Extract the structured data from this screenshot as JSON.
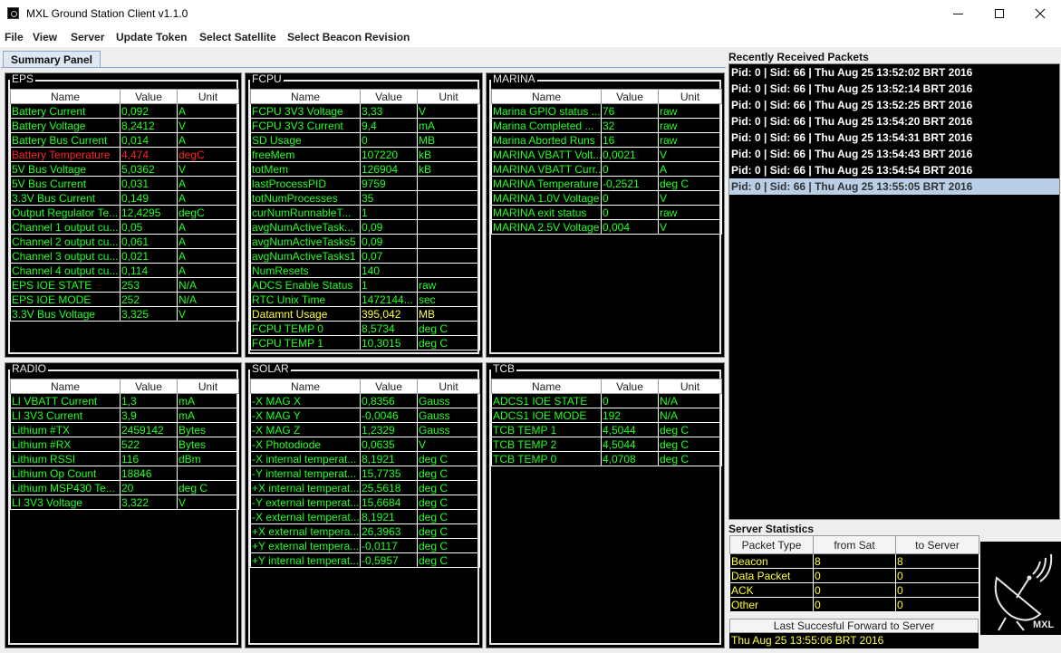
{
  "window": {
    "title": "MXL Ground Station Client v1.1.0"
  },
  "menu": [
    "File",
    "View",
    "Server",
    "Update Token",
    "Select Satellite",
    "Select Beacon Revision"
  ],
  "tabs": [
    {
      "label": "Summary Panel",
      "active": true
    }
  ],
  "columns": {
    "name": "Name",
    "value": "Value",
    "unit": "Unit"
  },
  "panels": {
    "eps": {
      "title": "EPS",
      "rows": [
        {
          "name": "Battery Current",
          "value": "0,092",
          "unit": "A"
        },
        {
          "name": "Battery Voltage",
          "value": "8,2412",
          "unit": "V"
        },
        {
          "name": "Battery Bus Current",
          "value": "0,014",
          "unit": "A"
        },
        {
          "name": "Battery Temperature",
          "value": "4,474",
          "unit": "degC",
          "alert": "red"
        },
        {
          "name": "5V Bus Voltage",
          "value": "5,0362",
          "unit": "V"
        },
        {
          "name": "5V Bus Current",
          "value": "0,031",
          "unit": "A"
        },
        {
          "name": "3.3V Bus Current",
          "value": "0,149",
          "unit": "A"
        },
        {
          "name": "Output Regulator Te...",
          "value": "12,4295",
          "unit": "degC"
        },
        {
          "name": "Channel 1 output cu...",
          "value": "0,05",
          "unit": "A"
        },
        {
          "name": "Channel 2 output cu...",
          "value": "0,061",
          "unit": "A"
        },
        {
          "name": "Channel 3 output cu...",
          "value": "0,021",
          "unit": "A"
        },
        {
          "name": "Channel 4 output cu...",
          "value": "0,114",
          "unit": "A"
        },
        {
          "name": "EPS IOE STATE",
          "value": "253",
          "unit": "N/A"
        },
        {
          "name": "EPS IOE MODE",
          "value": "252",
          "unit": "N/A"
        },
        {
          "name": "3.3V Bus Voltage",
          "value": "3,325",
          "unit": "V"
        }
      ]
    },
    "fcpu": {
      "title": "FCPU",
      "rows": [
        {
          "name": "FCPU 3V3 Voltage",
          "value": "3,33",
          "unit": "V"
        },
        {
          "name": "FCPU 3V3 Current",
          "value": "9,4",
          "unit": "mA"
        },
        {
          "name": "SD Usage",
          "value": "0",
          "unit": "MB"
        },
        {
          "name": "freeMem",
          "value": "107220",
          "unit": "kB"
        },
        {
          "name": "totMem",
          "value": "126904",
          "unit": "kB"
        },
        {
          "name": "lastProcessPID",
          "value": "9759",
          "unit": ""
        },
        {
          "name": "totNumProcesses",
          "value": "35",
          "unit": ""
        },
        {
          "name": "curNumRunnableT...",
          "value": "1",
          "unit": ""
        },
        {
          "name": "avgNumActiveTask...",
          "value": "0,09",
          "unit": ""
        },
        {
          "name": "avgNumActiveTasks5",
          "value": "0,09",
          "unit": ""
        },
        {
          "name": "avgNumActiveTasks1",
          "value": "0,07",
          "unit": ""
        },
        {
          "name": "NumResets",
          "value": "140",
          "unit": ""
        },
        {
          "name": "ADCS Enable Status",
          "value": "1",
          "unit": "raw"
        },
        {
          "name": "RTC Unix Time",
          "value": "1472144...",
          "unit": "sec"
        },
        {
          "name": "Datamnt Usage",
          "value": "395,042",
          "unit": "MB",
          "alert": "yellow"
        },
        {
          "name": "FCPU TEMP 0",
          "value": "8,5734",
          "unit": "deg C"
        },
        {
          "name": "FCPU TEMP 1",
          "value": "10,3015",
          "unit": "deg C"
        }
      ]
    },
    "marina": {
      "title": "MARINA",
      "rows": [
        {
          "name": "Marina GPIO status ...",
          "value": "76",
          "unit": "raw"
        },
        {
          "name": "Marina Completed ...",
          "value": "32",
          "unit": "raw"
        },
        {
          "name": "Marina Aborted Runs",
          "value": "16",
          "unit": "raw"
        },
        {
          "name": "MARINA VBATT Volt...",
          "value": "0,0021",
          "unit": "V"
        },
        {
          "name": "MARINA VBATT Curr...",
          "value": "0",
          "unit": "A"
        },
        {
          "name": "MARINA Temperature",
          "value": "-0,2521",
          "unit": "deg C"
        },
        {
          "name": "MARINA 1.0V Voltage",
          "value": "0",
          "unit": "V"
        },
        {
          "name": "MARINA exit status",
          "value": "0",
          "unit": "raw"
        },
        {
          "name": "MARINA 2.5V Voltage",
          "value": "0,004",
          "unit": "V"
        }
      ]
    },
    "radio": {
      "title": "RADIO",
      "rows": [
        {
          "name": "LI VBATT Current",
          "value": "1,3",
          "unit": "mA"
        },
        {
          "name": "LI 3V3 Current",
          "value": "3,9",
          "unit": "mA"
        },
        {
          "name": "Lithium #TX",
          "value": "2459142",
          "unit": "Bytes"
        },
        {
          "name": "Lithium #RX",
          "value": "522",
          "unit": "Bytes"
        },
        {
          "name": "Lithium RSSI",
          "value": "116",
          "unit": "dBm"
        },
        {
          "name": "Lithium Op Count",
          "value": "18846",
          "unit": ""
        },
        {
          "name": "Lithium MSP430 Te...",
          "value": "20",
          "unit": "deg C"
        },
        {
          "name": "LI 3V3 Voltage",
          "value": "3,322",
          "unit": "V"
        }
      ]
    },
    "solar": {
      "title": "SOLAR",
      "rows": [
        {
          "name": "-X MAG X",
          "value": "0,8356",
          "unit": "Gauss"
        },
        {
          "name": "-X MAG Y",
          "value": "-0,0046",
          "unit": "Gauss"
        },
        {
          "name": "-X MAG Z",
          "value": "1,2329",
          "unit": "Gauss"
        },
        {
          "name": "-X Photodiode",
          "value": "0,0635",
          "unit": "V"
        },
        {
          "name": "-X internal temperat...",
          "value": "8,1921",
          "unit": "deg C"
        },
        {
          "name": "-Y internal temperat...",
          "value": "15,7735",
          "unit": "deg C"
        },
        {
          "name": "+X internal temperat...",
          "value": "25,5618",
          "unit": "deg C"
        },
        {
          "name": "-Y external temperat...",
          "value": "15,6684",
          "unit": "deg C"
        },
        {
          "name": "-X external temperat...",
          "value": "8,1921",
          "unit": "deg C"
        },
        {
          "name": "+X external tempera...",
          "value": "26,3963",
          "unit": "deg C"
        },
        {
          "name": "+Y external tempera...",
          "value": "-0,0117",
          "unit": "deg C"
        },
        {
          "name": "+Y internal temperat...",
          "value": "-0,5957",
          "unit": "deg C"
        }
      ]
    },
    "tcb": {
      "title": "TCB",
      "rows": [
        {
          "name": "ADCS1 IOE STATE",
          "value": "0",
          "unit": "N/A"
        },
        {
          "name": "ADCS1 IOE MODE",
          "value": "192",
          "unit": "N/A"
        },
        {
          "name": "TCB TEMP 1",
          "value": "4,5044",
          "unit": "deg C"
        },
        {
          "name": "TCB TEMP 2",
          "value": "4,5044",
          "unit": "deg C"
        },
        {
          "name": "TCB TEMP 0",
          "value": "4,0708",
          "unit": "deg C"
        }
      ]
    }
  },
  "packets": {
    "label": "Recently Received Packets",
    "items": [
      "Pid: 0 | Sid: 66 | Thu Aug 25 13:52:02 BRT 2016",
      "Pid: 0 | Sid: 66 | Thu Aug 25 13:52:14 BRT 2016",
      "Pid: 0 | Sid: 66 | Thu Aug 25 13:52:25 BRT 2016",
      "Pid: 0 | Sid: 66 | Thu Aug 25 13:54:20 BRT 2016",
      "Pid: 0 | Sid: 66 | Thu Aug 25 13:54:31 BRT 2016",
      "Pid: 0 | Sid: 66 | Thu Aug 25 13:54:43 BRT 2016",
      "Pid: 0 | Sid: 66 | Thu Aug 25 13:54:54 BRT 2016",
      "Pid: 0 | Sid: 66 | Thu Aug 25 13:55:05 BRT 2016"
    ],
    "selected_index": 7
  },
  "server_stats": {
    "label": "Server Statistics",
    "headers": [
      "Packet Type",
      "from Sat",
      "to Server"
    ],
    "rows": [
      {
        "type": "Beacon",
        "from_sat": "8",
        "to_server": "8"
      },
      {
        "type": "Data Packet",
        "from_sat": "0",
        "to_server": "0"
      },
      {
        "type": "ACK",
        "from_sat": "0",
        "to_server": "0"
      },
      {
        "type": "Other",
        "from_sat": "0",
        "to_server": "0"
      }
    ]
  },
  "last_forward": {
    "label": "Last Succesful Forward to Server",
    "value": "Thu Aug 25 13:55:06 BRT 2016"
  },
  "logo": {
    "text": "MXL",
    "icon": "satellite-dish-icon"
  },
  "colors": {
    "value_text": "#22ff22",
    "alert_red": "#ff2222",
    "alert_yellow": "#ffff33",
    "panel_bg": "#000000",
    "selection": "#b8cfe5"
  }
}
